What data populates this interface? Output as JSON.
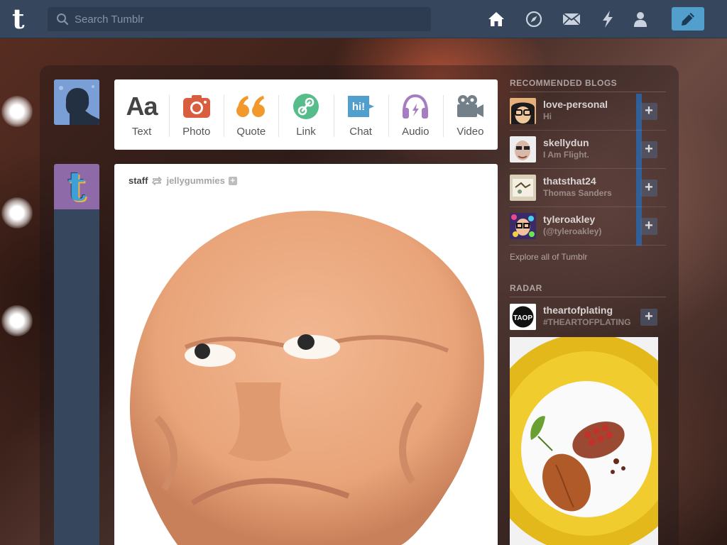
{
  "header": {
    "search_placeholder": "Search Tumblr",
    "logo_glyph": "t",
    "nav_icons": [
      "home-icon",
      "compass-icon",
      "mail-icon",
      "lightning-icon",
      "account-icon"
    ],
    "compose_icon": "pencil-icon",
    "colors": {
      "bar": "#36465d",
      "compose": "#529ecc"
    }
  },
  "post_types": [
    {
      "label": "Text",
      "icon": "text-icon",
      "color": "#444444"
    },
    {
      "label": "Photo",
      "icon": "camera-icon",
      "color": "#d95e40"
    },
    {
      "label": "Quote",
      "icon": "quote-icon",
      "color": "#f2992e"
    },
    {
      "label": "Link",
      "icon": "link-icon",
      "color": "#56bc8a"
    },
    {
      "label": "Chat",
      "icon": "chat-icon",
      "color": "#529ecc"
    },
    {
      "label": "Audio",
      "icon": "headphones-icon",
      "color": "#a77dc2"
    },
    {
      "label": "Video",
      "icon": "video-camera-icon",
      "color": "#748089"
    }
  ],
  "post": {
    "author": "staff",
    "reblog_icon": "reblog-icon",
    "source": "jellygummies",
    "follow_glyph": "+"
  },
  "sidebar": {
    "recommended_heading": "RECOMMENDED BLOGS",
    "blogs": [
      {
        "name": "love-personal",
        "desc": "Hi",
        "follow": "+"
      },
      {
        "name": "skellydun",
        "desc": "I Am Flight.",
        "follow": "+"
      },
      {
        "name": "thatsthat24",
        "desc": "Thomas Sanders",
        "follow": "+"
      },
      {
        "name": "tyleroakley",
        "desc": "(@tyleroakley)",
        "follow": "+"
      }
    ],
    "explore": "Explore all of Tumblr",
    "radar_heading": "RADAR",
    "radar": {
      "name": "theartofplating",
      "desc": "#THEARTOFPLATING",
      "follow": "+",
      "avatar_text": "TAOP"
    }
  }
}
